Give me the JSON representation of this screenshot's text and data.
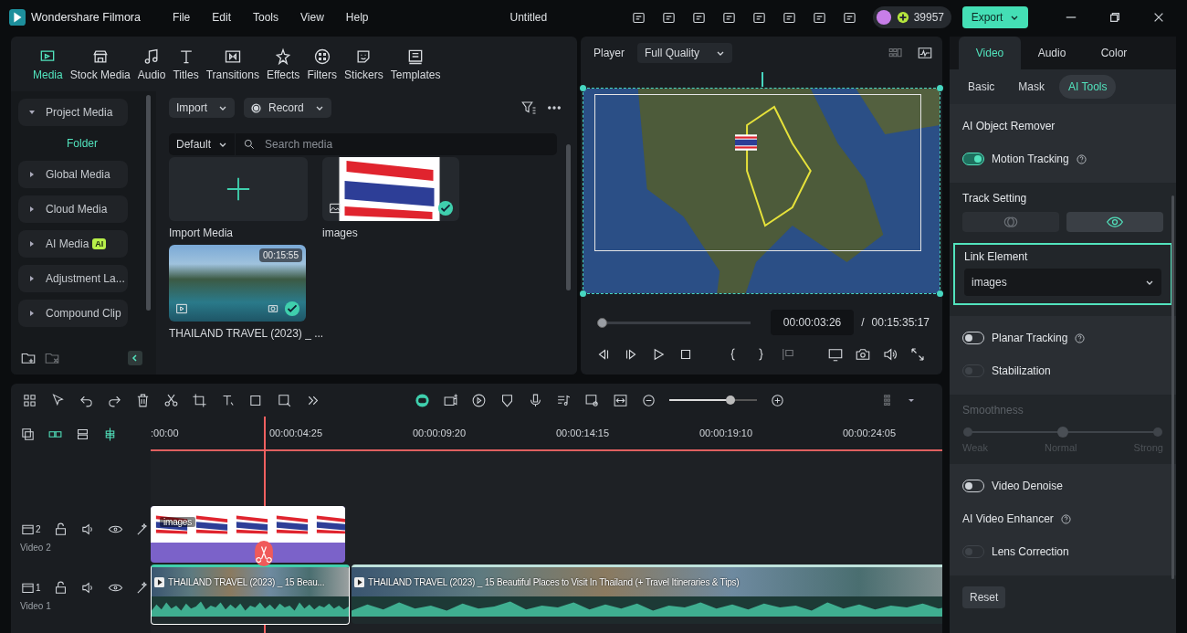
{
  "app_title": "Wondershare Filmora",
  "menu": [
    "File",
    "Edit",
    "Tools",
    "View",
    "Help"
  ],
  "document_title": "Untitled",
  "credits": "39957",
  "export_button": "Export",
  "media_tabs": [
    {
      "label": "Media",
      "selected": true
    },
    {
      "label": "Stock Media",
      "selected": false
    },
    {
      "label": "Audio",
      "selected": false
    },
    {
      "label": "Titles",
      "selected": false
    },
    {
      "label": "Transitions",
      "selected": false
    },
    {
      "label": "Effects",
      "selected": false
    },
    {
      "label": "Filters",
      "selected": false
    },
    {
      "label": "Stickers",
      "selected": false
    },
    {
      "label": "Templates",
      "selected": false
    }
  ],
  "library": {
    "items": [
      {
        "label": "Project Media",
        "expanded": true,
        "children": [
          {
            "label": "Folder"
          }
        ]
      },
      {
        "label": "Global Media",
        "expanded": false
      },
      {
        "label": "Cloud Media",
        "expanded": false
      },
      {
        "label": "AI Media",
        "badge": "AI",
        "expanded": false
      },
      {
        "label": "Adjustment La...",
        "expanded": false
      },
      {
        "label": "Compound Clip",
        "expanded": false
      }
    ]
  },
  "media_toolbar": {
    "import": "Import",
    "record": "Record",
    "sort": "Default",
    "search": {
      "placeholder": "Search media"
    }
  },
  "media_items": [
    {
      "kind": "add",
      "label": "Import Media"
    },
    {
      "kind": "image",
      "label": "images",
      "in_use": true
    },
    {
      "kind": "video",
      "label": "THAILAND TRAVEL (2023) _ ...",
      "duration": "00:15:55",
      "in_use": true
    }
  ],
  "player": {
    "label": "Player",
    "quality": "Full Quality",
    "scrubber": {
      "level": 0.0
    },
    "current_time": "00:00:03:26",
    "separator": "/",
    "total_time": "00:15:35:17"
  },
  "inspector": {
    "tabs": [
      {
        "label": "Video",
        "selected": true
      },
      {
        "label": "Audio",
        "selected": false
      },
      {
        "label": "Color",
        "selected": false
      }
    ],
    "subtabs": [
      {
        "label": "Basic",
        "selected": false
      },
      {
        "label": "Mask",
        "selected": false
      },
      {
        "label": "AI Tools",
        "selected": true
      }
    ],
    "sections": [
      {
        "controls": [
          {
            "kind": "heading",
            "label": "AI Object Remover"
          },
          {
            "kind": "toggle",
            "label": "Motion Tracking",
            "on": true,
            "disabled": false,
            "help": true
          }
        ]
      },
      {
        "controls": [
          {
            "kind": "segments",
            "label": "Track Setting",
            "options": [
              {
                "selected": false
              },
              {
                "selected": true
              }
            ]
          },
          {
            "kind": "dropdown",
            "label": "Link Element",
            "value": "images",
            "highlighted": true
          }
        ]
      },
      {
        "controls": [
          {
            "kind": "toggle",
            "label": "Planar Tracking",
            "on": false,
            "disabled": false,
            "help": true
          },
          {
            "kind": "toggle",
            "label": "Stabilization",
            "on": false,
            "disabled": true
          }
        ]
      },
      {
        "controls": [
          {
            "kind": "slider",
            "label": "Smoothness",
            "disabled": true,
            "level": 0.5,
            "stops": [
              "Weak",
              "Normal",
              "Strong"
            ]
          }
        ]
      },
      {
        "controls": [
          {
            "kind": "toggle",
            "label": "Video Denoise",
            "on": false,
            "disabled": false
          },
          {
            "kind": "heading",
            "label": "AI Video Enhancer",
            "help": true
          },
          {
            "kind": "toggle",
            "label": "Lens Correction",
            "on": false,
            "disabled": true
          }
        ]
      }
    ],
    "reset_button": "Reset"
  },
  "timeline": {
    "zoom": {
      "level": 0.7
    },
    "ruler": [
      ":00:00",
      "00:00:04:25",
      "00:00:09:20",
      "00:00:14:15",
      "00:00:19:10",
      "00:00:24:05"
    ],
    "tracks": [
      {
        "number": "2",
        "name": "Video 2",
        "clips": [
          {
            "kind": "image",
            "label": "images",
            "selected": false
          }
        ]
      },
      {
        "number": "1",
        "name": "Video 1",
        "clips": [
          {
            "kind": "video",
            "label": "THAILAND TRAVEL (2023) _ 15 Beau...",
            "selected": true
          },
          {
            "kind": "video",
            "label": "THAILAND TRAVEL (2023) _ 15 Beautiful Places to Visit In Thailand (+ Travel Itineraries & Tips)",
            "selected": false
          }
        ]
      }
    ]
  }
}
